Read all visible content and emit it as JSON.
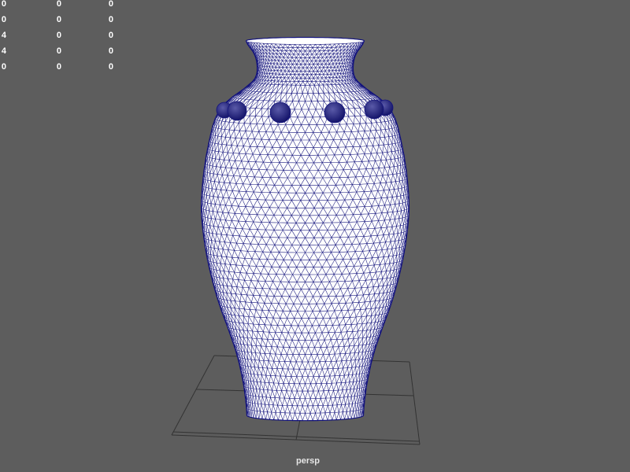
{
  "viewport": {
    "camera": "persp"
  },
  "hud": {
    "rows": [
      [
        "0",
        "0",
        "0"
      ],
      [
        "0",
        "0",
        "0"
      ],
      [
        "4",
        "0",
        "0"
      ],
      [
        "4",
        "0",
        "0"
      ],
      [
        "0",
        "0",
        "0"
      ]
    ]
  },
  "colors": {
    "background": "#5d5d5d",
    "hud_text": "#ffffff",
    "camera_label": "#e6e6e6",
    "wireframe": "#14147c",
    "surface": "#ffffff",
    "grid": "#333333",
    "knob_highlight": "#5a5aa8",
    "knob_shadow": "#0f0f66"
  }
}
